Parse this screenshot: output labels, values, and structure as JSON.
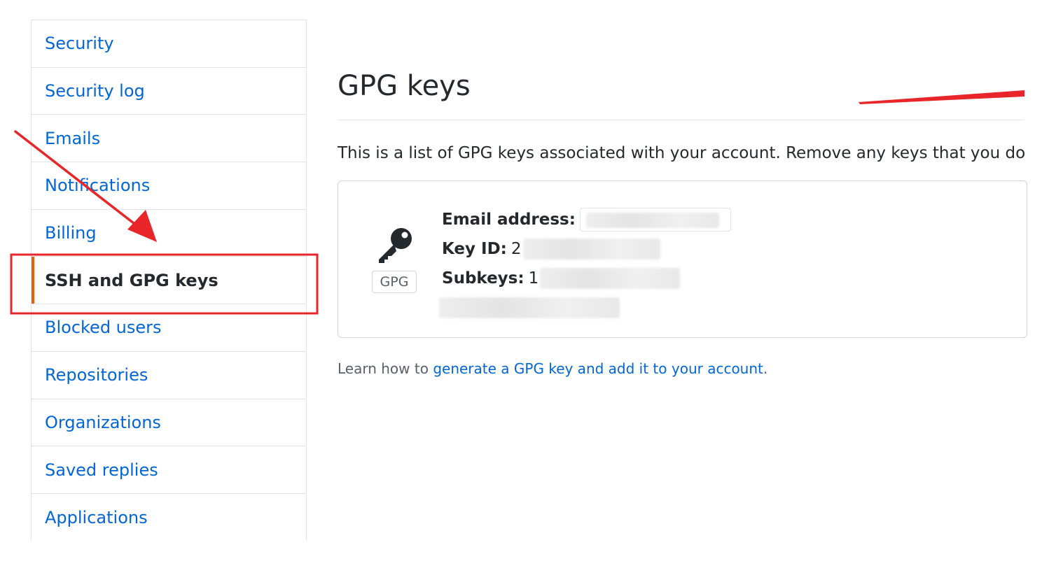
{
  "sidebar": {
    "items": [
      {
        "label": "Security"
      },
      {
        "label": "Security log"
      },
      {
        "label": "Emails"
      },
      {
        "label": "Notifications"
      },
      {
        "label": "Billing"
      },
      {
        "label": "SSH and GPG keys"
      },
      {
        "label": "Blocked users"
      },
      {
        "label": "Repositories"
      },
      {
        "label": "Organizations"
      },
      {
        "label": "Saved replies"
      },
      {
        "label": "Applications"
      }
    ],
    "selected_index": 5
  },
  "main": {
    "title": "GPG keys",
    "description": "This is a list of GPG keys associated with your account. Remove any keys that you do not",
    "key": {
      "badge": "GPG",
      "email_label": "Email address:",
      "key_id_label": "Key ID:",
      "key_id_visible": "2",
      "subkeys_label": "Subkeys:",
      "subkeys_visible": "1"
    },
    "help": {
      "prefix": "Learn how to ",
      "link": "generate a GPG key and add it to your account",
      "suffix": "."
    }
  },
  "colors": {
    "link": "#0366d6",
    "selected_accent": "#e36209",
    "annotation": "#e8262a"
  },
  "icons": {
    "key": "key-icon"
  }
}
